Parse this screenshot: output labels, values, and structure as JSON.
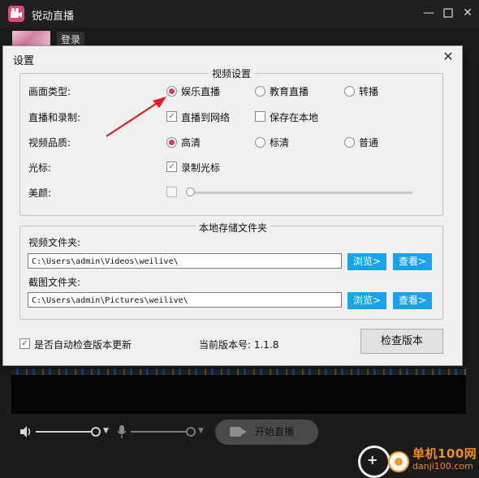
{
  "app": {
    "title": "锐动直播",
    "login_label": "登录",
    "start_live_label": "开始直播"
  },
  "dialog": {
    "title": "设置",
    "video_settings": {
      "title": "视频设置",
      "rows": [
        {
          "label": "画面类型:",
          "options": [
            "娱乐直播",
            "教育直播",
            "转播"
          ],
          "selected": "娱乐直播"
        },
        {
          "label": "直播和录制:",
          "options": [
            "直播到网络",
            "保存在本地"
          ],
          "checked": [
            "直播到网络"
          ]
        },
        {
          "label": "视频品质:",
          "options": [
            "高清",
            "标清",
            "普通"
          ],
          "selected": "高清"
        },
        {
          "label": "光标:",
          "options": [
            "录制光标"
          ],
          "checked": [
            "录制光标"
          ]
        },
        {
          "label": "美颜:",
          "beauty_enabled": false,
          "beauty_level": 0
        }
      ]
    },
    "storage": {
      "title": "本地存储文件夹",
      "video_folder_label": "视频文件夹:",
      "video_folder_path": "C:\\Users\\admin\\Videos\\weilive\\",
      "screenshot_folder_label": "截图文件夹:",
      "screenshot_folder_path": "C:\\Users\\admin\\Pictures\\weilive\\",
      "browse_label": "浏览>",
      "view_label": "查看>"
    },
    "auto_check_label": "是否自动检查版本更新",
    "auto_check_checked": true,
    "current_version_label": "当前版本号: 1.1.8",
    "check_version_label": "检查版本"
  },
  "watermark": {
    "name": "单机100网",
    "url": "danji100.com"
  },
  "colors": {
    "accent": "#d9356d",
    "button_blue": "#1aa3ea",
    "arrow_red": "#e02020",
    "dark_bg": "#1b1b1b"
  },
  "icons": {
    "volume": "speaker-icon",
    "mic": "microphone-icon",
    "camera": "camera-icon"
  }
}
